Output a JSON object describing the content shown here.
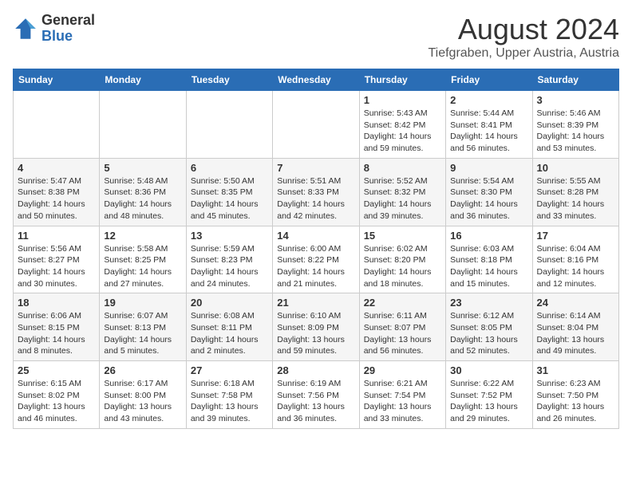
{
  "logo": {
    "general": "General",
    "blue": "Blue"
  },
  "title": "August 2024",
  "subtitle": "Tiefgraben, Upper Austria, Austria",
  "weekdays": [
    "Sunday",
    "Monday",
    "Tuesday",
    "Wednesday",
    "Thursday",
    "Friday",
    "Saturday"
  ],
  "weeks": [
    [
      {
        "day": "",
        "info": ""
      },
      {
        "day": "",
        "info": ""
      },
      {
        "day": "",
        "info": ""
      },
      {
        "day": "",
        "info": ""
      },
      {
        "day": "1",
        "info": "Sunrise: 5:43 AM\nSunset: 8:42 PM\nDaylight: 14 hours\nand 59 minutes."
      },
      {
        "day": "2",
        "info": "Sunrise: 5:44 AM\nSunset: 8:41 PM\nDaylight: 14 hours\nand 56 minutes."
      },
      {
        "day": "3",
        "info": "Sunrise: 5:46 AM\nSunset: 8:39 PM\nDaylight: 14 hours\nand 53 minutes."
      }
    ],
    [
      {
        "day": "4",
        "info": "Sunrise: 5:47 AM\nSunset: 8:38 PM\nDaylight: 14 hours\nand 50 minutes."
      },
      {
        "day": "5",
        "info": "Sunrise: 5:48 AM\nSunset: 8:36 PM\nDaylight: 14 hours\nand 48 minutes."
      },
      {
        "day": "6",
        "info": "Sunrise: 5:50 AM\nSunset: 8:35 PM\nDaylight: 14 hours\nand 45 minutes."
      },
      {
        "day": "7",
        "info": "Sunrise: 5:51 AM\nSunset: 8:33 PM\nDaylight: 14 hours\nand 42 minutes."
      },
      {
        "day": "8",
        "info": "Sunrise: 5:52 AM\nSunset: 8:32 PM\nDaylight: 14 hours\nand 39 minutes."
      },
      {
        "day": "9",
        "info": "Sunrise: 5:54 AM\nSunset: 8:30 PM\nDaylight: 14 hours\nand 36 minutes."
      },
      {
        "day": "10",
        "info": "Sunrise: 5:55 AM\nSunset: 8:28 PM\nDaylight: 14 hours\nand 33 minutes."
      }
    ],
    [
      {
        "day": "11",
        "info": "Sunrise: 5:56 AM\nSunset: 8:27 PM\nDaylight: 14 hours\nand 30 minutes."
      },
      {
        "day": "12",
        "info": "Sunrise: 5:58 AM\nSunset: 8:25 PM\nDaylight: 14 hours\nand 27 minutes."
      },
      {
        "day": "13",
        "info": "Sunrise: 5:59 AM\nSunset: 8:23 PM\nDaylight: 14 hours\nand 24 minutes."
      },
      {
        "day": "14",
        "info": "Sunrise: 6:00 AM\nSunset: 8:22 PM\nDaylight: 14 hours\nand 21 minutes."
      },
      {
        "day": "15",
        "info": "Sunrise: 6:02 AM\nSunset: 8:20 PM\nDaylight: 14 hours\nand 18 minutes."
      },
      {
        "day": "16",
        "info": "Sunrise: 6:03 AM\nSunset: 8:18 PM\nDaylight: 14 hours\nand 15 minutes."
      },
      {
        "day": "17",
        "info": "Sunrise: 6:04 AM\nSunset: 8:16 PM\nDaylight: 14 hours\nand 12 minutes."
      }
    ],
    [
      {
        "day": "18",
        "info": "Sunrise: 6:06 AM\nSunset: 8:15 PM\nDaylight: 14 hours\nand 8 minutes."
      },
      {
        "day": "19",
        "info": "Sunrise: 6:07 AM\nSunset: 8:13 PM\nDaylight: 14 hours\nand 5 minutes."
      },
      {
        "day": "20",
        "info": "Sunrise: 6:08 AM\nSunset: 8:11 PM\nDaylight: 14 hours\nand 2 minutes."
      },
      {
        "day": "21",
        "info": "Sunrise: 6:10 AM\nSunset: 8:09 PM\nDaylight: 13 hours\nand 59 minutes."
      },
      {
        "day": "22",
        "info": "Sunrise: 6:11 AM\nSunset: 8:07 PM\nDaylight: 13 hours\nand 56 minutes."
      },
      {
        "day": "23",
        "info": "Sunrise: 6:12 AM\nSunset: 8:05 PM\nDaylight: 13 hours\nand 52 minutes."
      },
      {
        "day": "24",
        "info": "Sunrise: 6:14 AM\nSunset: 8:04 PM\nDaylight: 13 hours\nand 49 minutes."
      }
    ],
    [
      {
        "day": "25",
        "info": "Sunrise: 6:15 AM\nSunset: 8:02 PM\nDaylight: 13 hours\nand 46 minutes."
      },
      {
        "day": "26",
        "info": "Sunrise: 6:17 AM\nSunset: 8:00 PM\nDaylight: 13 hours\nand 43 minutes."
      },
      {
        "day": "27",
        "info": "Sunrise: 6:18 AM\nSunset: 7:58 PM\nDaylight: 13 hours\nand 39 minutes."
      },
      {
        "day": "28",
        "info": "Sunrise: 6:19 AM\nSunset: 7:56 PM\nDaylight: 13 hours\nand 36 minutes."
      },
      {
        "day": "29",
        "info": "Sunrise: 6:21 AM\nSunset: 7:54 PM\nDaylight: 13 hours\nand 33 minutes."
      },
      {
        "day": "30",
        "info": "Sunrise: 6:22 AM\nSunset: 7:52 PM\nDaylight: 13 hours\nand 29 minutes."
      },
      {
        "day": "31",
        "info": "Sunrise: 6:23 AM\nSunset: 7:50 PM\nDaylight: 13 hours\nand 26 minutes."
      }
    ]
  ]
}
